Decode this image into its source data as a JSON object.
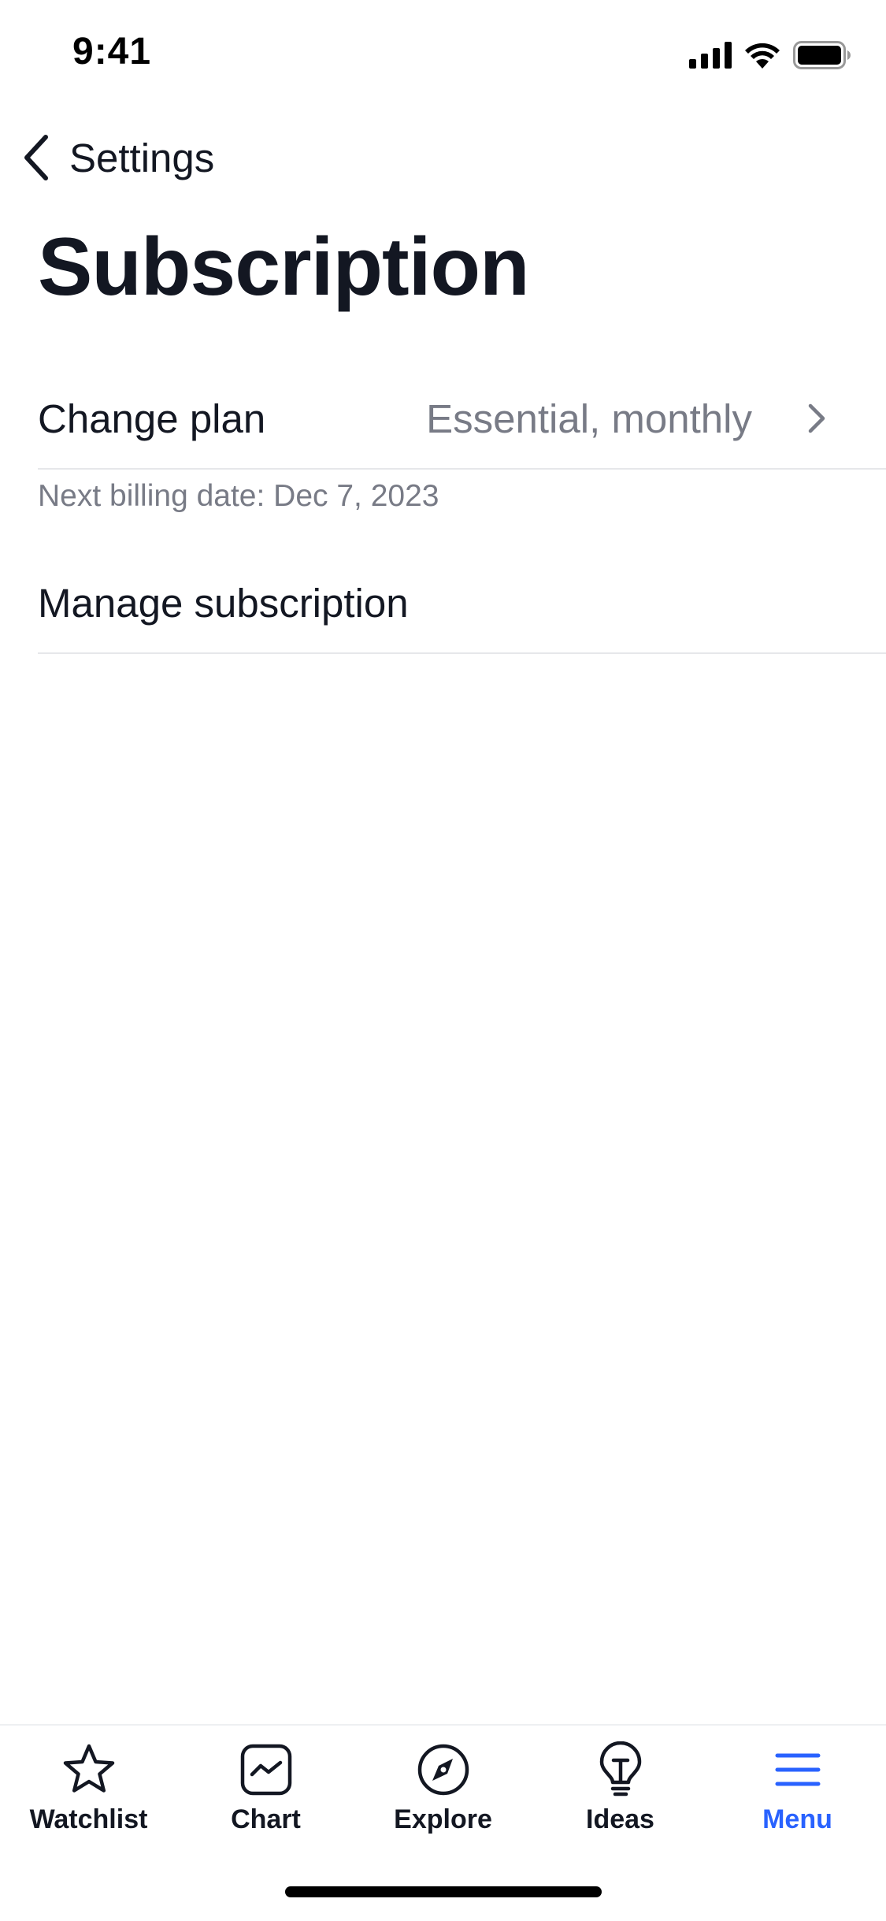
{
  "status_bar": {
    "time": "9:41",
    "icons": [
      "cellular-signal-icon",
      "wifi-icon",
      "battery-icon"
    ]
  },
  "nav": {
    "back_label": "Settings",
    "back_icon": "chevron-left-icon"
  },
  "page": {
    "title": "Subscription"
  },
  "plan_row": {
    "label": "Change plan",
    "value": "Essential, monthly",
    "icon": "chevron-right-icon"
  },
  "billing": {
    "note": "Next billing date: Dec 7, 2023"
  },
  "manage_row": {
    "label": "Manage subscription"
  },
  "tab_bar": {
    "active_color": "#2962ff",
    "tabs": [
      {
        "label": "Watchlist",
        "icon": "star-icon",
        "active": false
      },
      {
        "label": "Chart",
        "icon": "chart-icon",
        "active": false
      },
      {
        "label": "Explore",
        "icon": "compass-icon",
        "active": false
      },
      {
        "label": "Ideas",
        "icon": "lightbulb-icon",
        "active": false
      },
      {
        "label": "Menu",
        "icon": "menu-icon",
        "active": true
      }
    ]
  }
}
